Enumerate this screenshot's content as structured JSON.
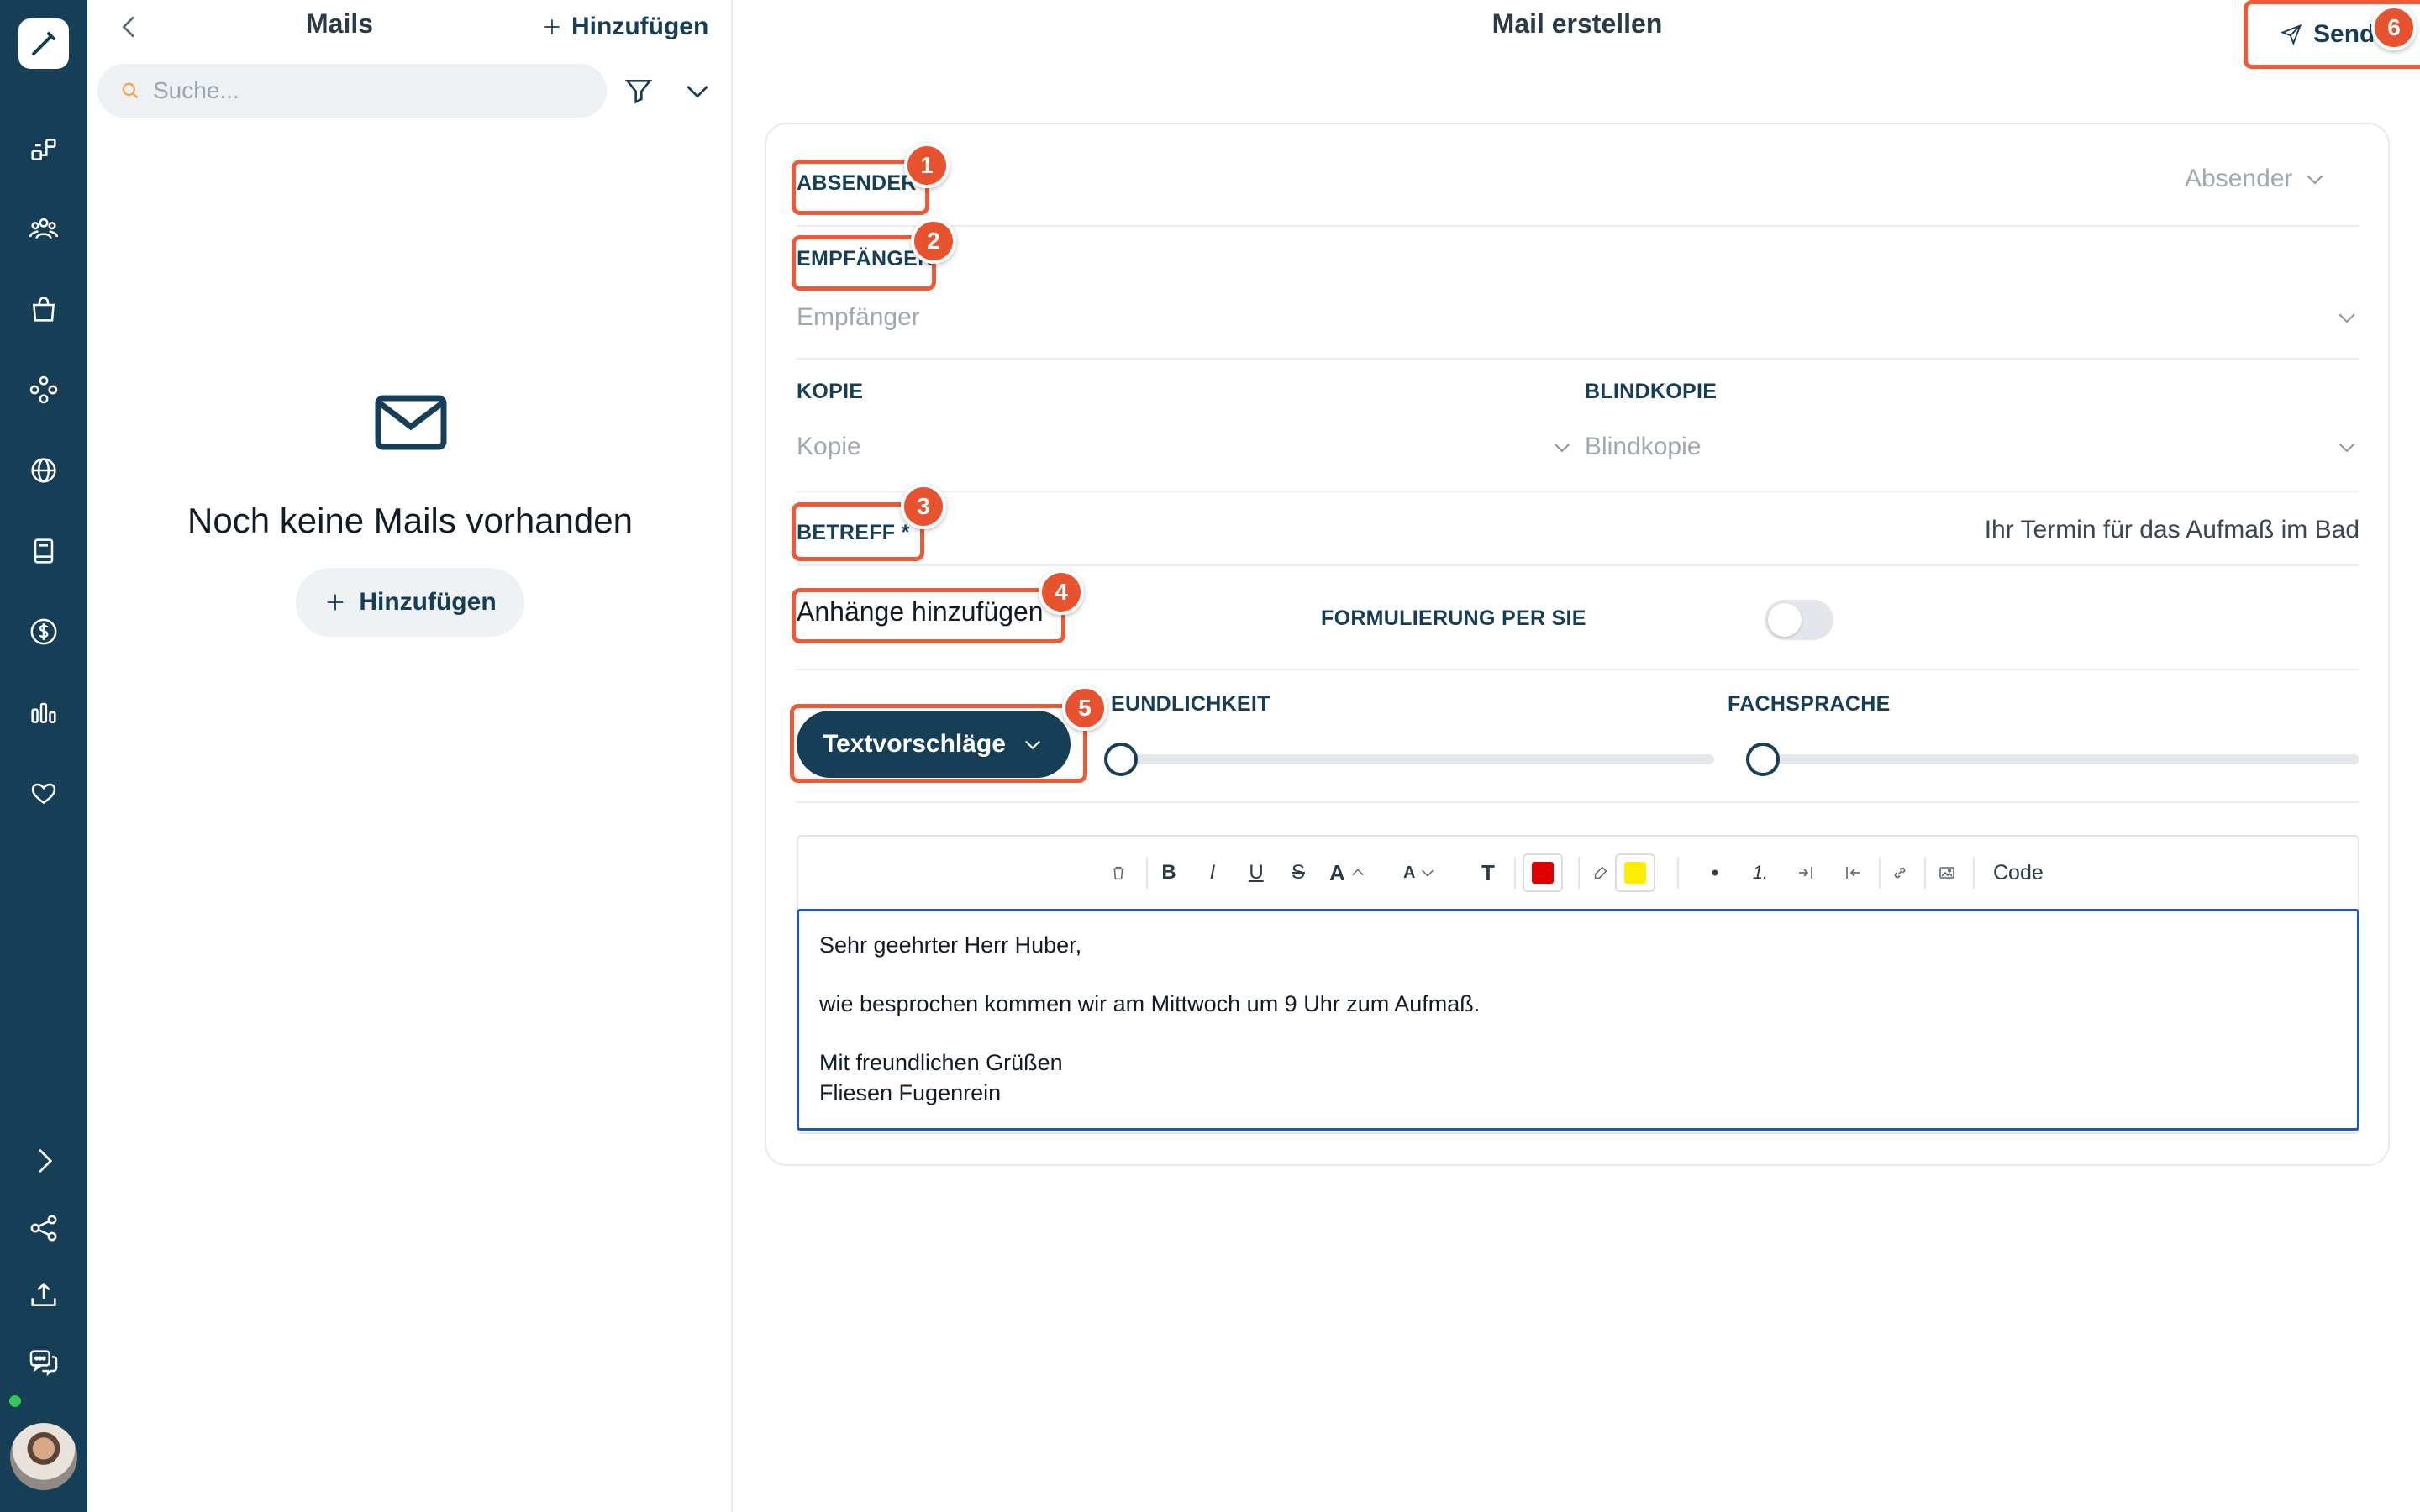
{
  "rail": {
    "icons": [
      "pen-logo-icon",
      "workflow-icon",
      "users-icon",
      "shopping-bag-icon",
      "modules-icon",
      "globe-icon",
      "book-icon",
      "dollar-icon",
      "chart-icon",
      "heart-icon",
      "chevron-right-icon",
      "share-icon",
      "upload-icon",
      "chat-icon"
    ]
  },
  "list": {
    "title": "Mails",
    "add_label": "Hinzufügen",
    "search_placeholder": "Suche...",
    "empty_text": "Noch keine Mails vorhanden",
    "empty_add_label": "Hinzufügen"
  },
  "compose": {
    "title": "Mail erstellen",
    "send_label": "Send",
    "sender_label": "ABSENDER",
    "sender_placeholder": "Absender",
    "recipient_label": "EMPFÄNGER",
    "recipient_placeholder": "Empfänger",
    "cc_label": "KOPIE",
    "cc_placeholder": "Kopie",
    "bcc_label": "BLINDKOPIE",
    "bcc_placeholder": "Blindkopie",
    "subject_label": "BETREFF *",
    "subject_value": "Ihr Termin für das Aufmaß im Bad",
    "attachments_label": "Anhänge hinzufügen",
    "formal_label": "FORMULIERUNG PER SIE",
    "formal_on": false,
    "suggestions_label": "Textvorschläge",
    "friendliness_label": "EUNDLICHKEIT",
    "jargon_label": "FACHSPRACHE",
    "friendliness_value": 0,
    "jargon_value": 0
  },
  "editor": {
    "toolbar": {
      "bold": "B",
      "italic": "I",
      "underline": "U",
      "strike": "S",
      "font_up": "A",
      "font_down": "A",
      "text_style": "T",
      "ordered": "1.",
      "code": "Code"
    },
    "text_color": "#e00000",
    "highlight_color": "#ffee00",
    "body": {
      "greeting": "Sehr geehrter Herr Huber,",
      "line1": "wie besprochen kommen wir am Mittwoch um 9 Uhr zum Aufmaß.",
      "closing": "Mit freundlichen Grüßen",
      "signature": "Fliesen Fugenrein"
    }
  },
  "badges": [
    "1",
    "2",
    "3",
    "4",
    "5",
    "6"
  ],
  "colors": {
    "rail": "#163e57",
    "accent": "#163e57",
    "highlight": "#ea5b3a",
    "editor_focus": "#1e5ab4"
  }
}
